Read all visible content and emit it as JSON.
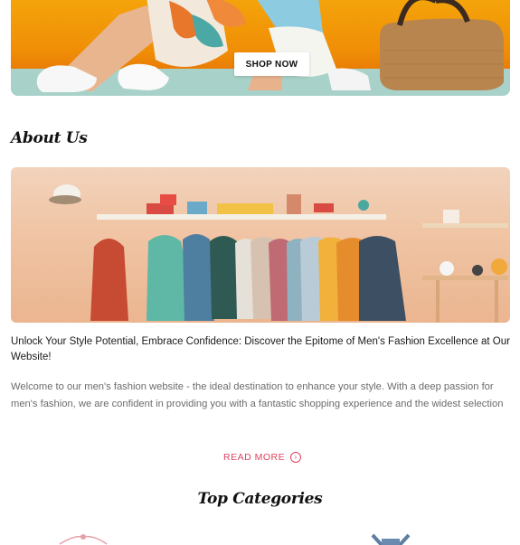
{
  "hero": {
    "button_label": "SHOP NOW"
  },
  "about": {
    "title": "About Us",
    "headline": "Unlock Your Style Potential, Embrace Confidence: Discover the Epitome of Men's Fashion Excellence at Our Website!",
    "body": "Welcome to our men's fashion website - the ideal destination to enhance your style. With a deep passion for men's fashion, we are confident in providing you with a fantastic shopping experience and the widest selection",
    "read_more_label": "READ MORE",
    "read_more_icon": "arrow-circle-right-icon"
  },
  "categories": {
    "title": "Top Categories"
  },
  "colors": {
    "accent": "#e0425e",
    "hero_bg": "#f4a50b"
  }
}
